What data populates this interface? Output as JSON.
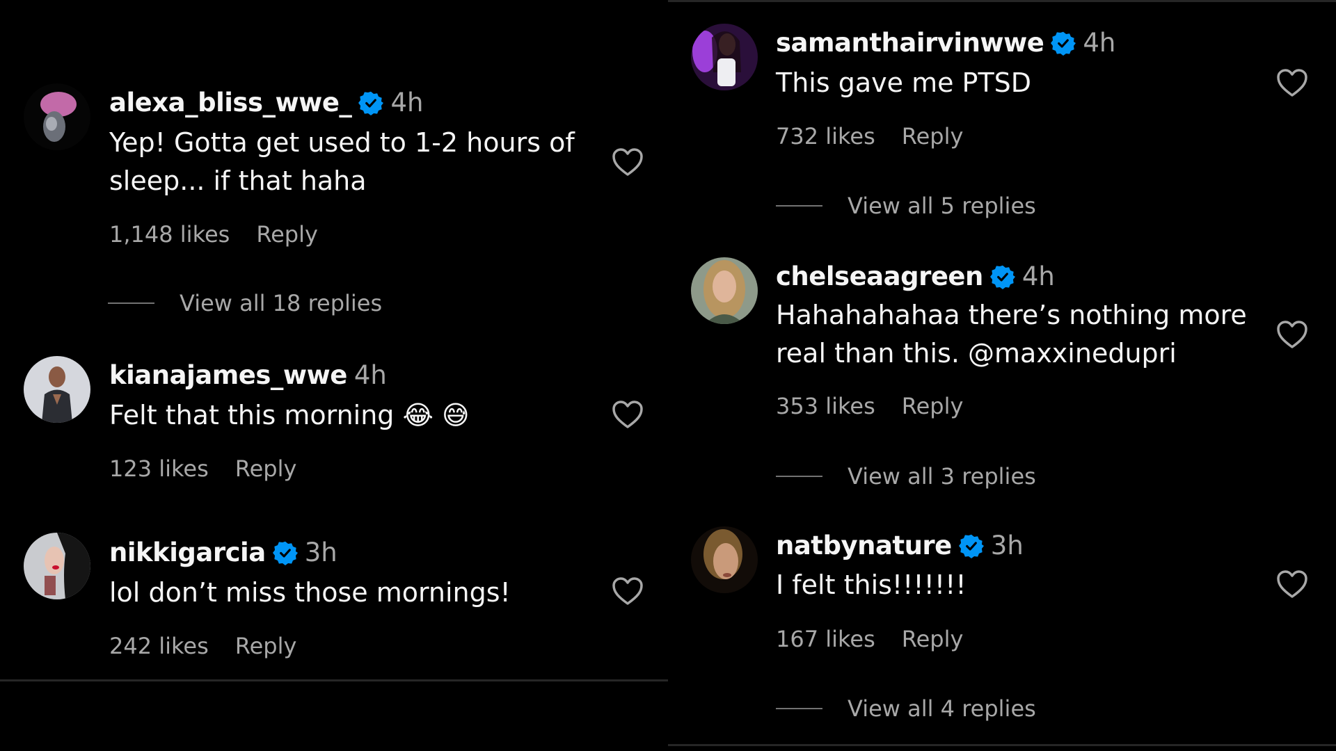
{
  "colors": {
    "background": "#000000",
    "primary_text": "#f5f5f5",
    "secondary_text": "#a8a8a8",
    "verified_badge": "#0095f6",
    "divider": "#262626"
  },
  "left_column": {
    "comments": [
      {
        "username": "alexa_bliss_wwe_",
        "verified": true,
        "time": "4h",
        "text_lines": [
          "Yep! Gotta get used to 1-2 hours of",
          "sleep... if that haha"
        ],
        "likes": "1,148 likes",
        "reply": "Reply",
        "view_replies": "View all 18 replies",
        "like_icon": "heart-outline-icon"
      },
      {
        "username": "kianajames_wwe",
        "verified": false,
        "time": "4h",
        "text_lines": [
          "Felt that this morning 😂 😅"
        ],
        "likes": "123 likes",
        "reply": "Reply",
        "like_icon": "heart-outline-icon"
      },
      {
        "username": "nikkigarcia",
        "verified": true,
        "time": "3h",
        "text_lines": [
          "lol don’t miss those mornings!"
        ],
        "likes": "242 likes",
        "reply": "Reply",
        "like_icon": "heart-outline-icon"
      }
    ]
  },
  "right_column": {
    "comments": [
      {
        "username": "samanthairvinwwe",
        "verified": true,
        "time": "4h",
        "text_lines": [
          "This gave me PTSD"
        ],
        "likes": "732 likes",
        "reply": "Reply",
        "view_replies": "View all 5 replies",
        "like_icon": "heart-outline-icon"
      },
      {
        "username": "chelseaagreen",
        "verified": true,
        "time": "4h",
        "text_lines": [
          "Hahahahahaa there’s nothing more",
          "real than this. @maxxinedupri"
        ],
        "likes": "353 likes",
        "reply": "Reply",
        "view_replies": "View all 3 replies",
        "like_icon": "heart-outline-icon"
      },
      {
        "username": "natbynature",
        "verified": true,
        "time": "3h",
        "text_lines": [
          "I felt this!!!!!!!"
        ],
        "likes": "167 likes",
        "reply": "Reply",
        "view_replies": "View all 4 replies",
        "like_icon": "heart-outline-icon"
      }
    ]
  }
}
